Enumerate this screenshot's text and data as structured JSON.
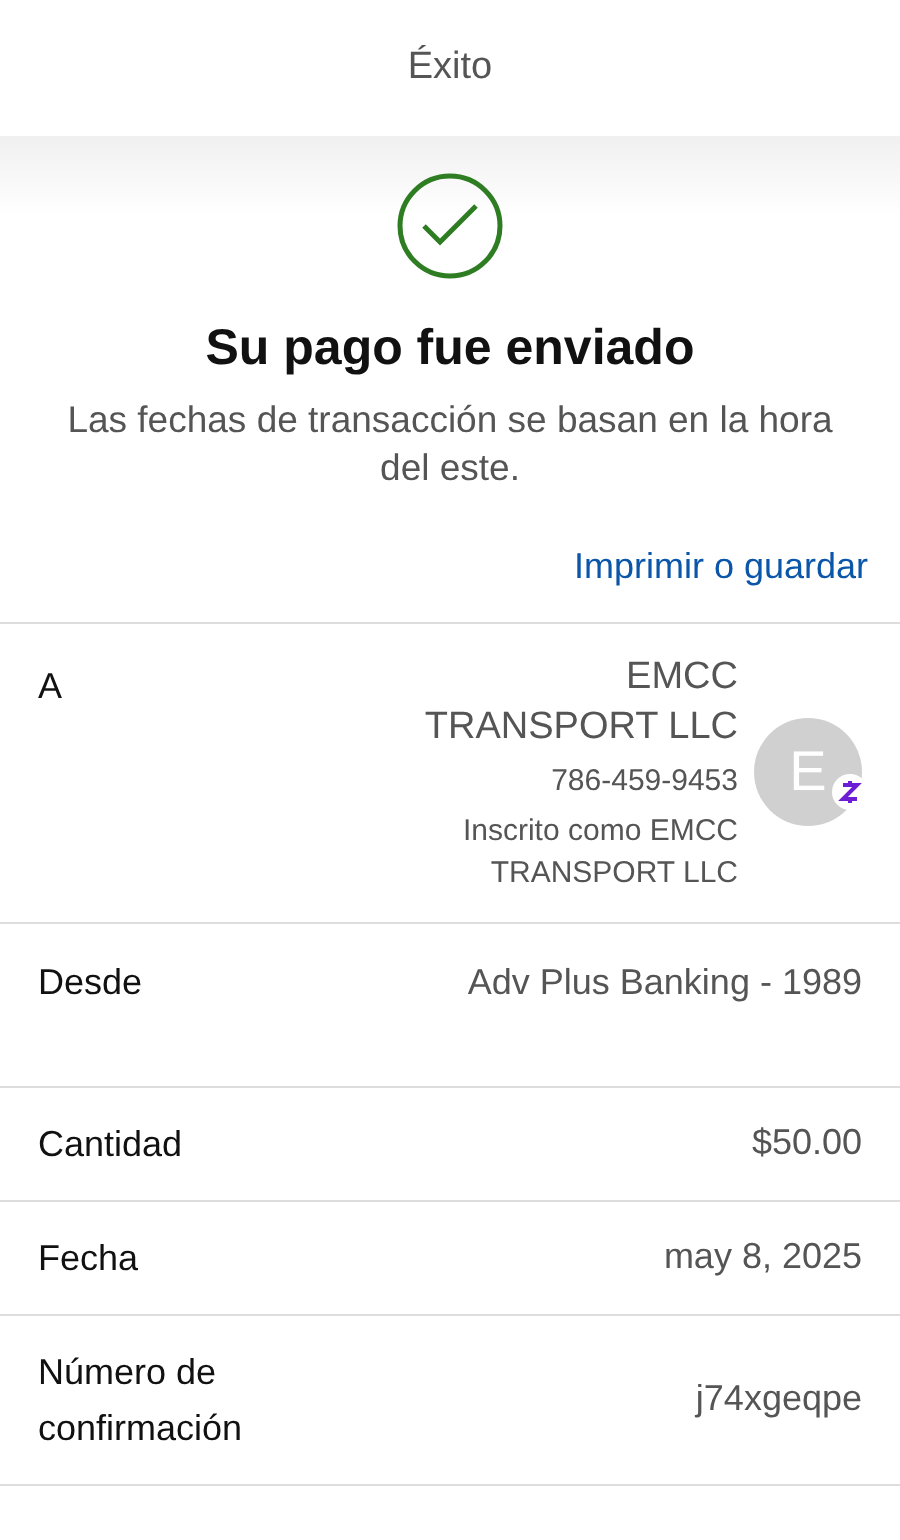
{
  "header": {
    "title": "Éxito"
  },
  "status": {
    "kind": "success",
    "title": "Su pago fue enviado",
    "note": "Las fechas de transacción se basan en la hora del este."
  },
  "print_link": "Imprimir o guardar",
  "details": [
    {
      "kind": "recipient",
      "label": "A",
      "name": "EMCC TRANSPORT LLC",
      "phone": "786-459-9453",
      "enrolled": "Inscrito como EMCC TRANSPORT LLC",
      "avatar_initial": "E"
    },
    {
      "kind": "tall",
      "label": "Desde",
      "value": "Adv Plus Banking - 1989"
    },
    {
      "kind": "plain",
      "label": "Cantidad",
      "value": "$50.00"
    },
    {
      "kind": "plain",
      "label": "Fecha",
      "value": "may 8, 2025"
    },
    {
      "kind": "plain",
      "label": "Número de confirmación",
      "value": "j74xgeqpe"
    }
  ]
}
